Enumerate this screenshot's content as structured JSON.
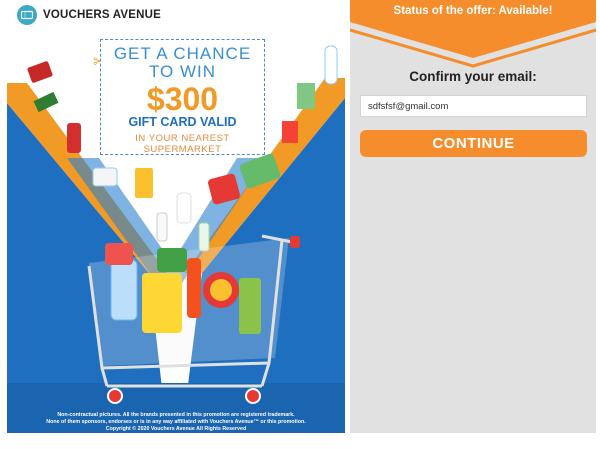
{
  "brand": {
    "name": "VOUCHERS AVENUE",
    "icon": "ticket-icon"
  },
  "promo": {
    "line1": "GET A CHANCE",
    "line2": "TO WIN",
    "amount": "$300",
    "line3": "GIFT CARD VALID",
    "line4a": "IN YOUR NEAREST",
    "line4b": "SUPERMARKET"
  },
  "disclaimer": {
    "line1": "Non-contractual pictures. All the brands presented in this promotion are registered trademark.",
    "line2": "None of them sponsors, endorses or is in any way affiliated with Vouchers Avenue™ or this promotion.",
    "line3": "Copyright © 2020 Vouchers Avenue All Rights Reserved"
  },
  "offer": {
    "status_text": "Status of the offer: Available!",
    "confirm_label": "Confirm your email:",
    "email_value": "sdfsfsf@gmail.com",
    "continue_label": "CONTINUE"
  },
  "colors": {
    "accent": "#f58d2c",
    "panel": "#e1e1e1",
    "blue": "#1f6fc0",
    "brand_icon": "#3aaac6"
  }
}
